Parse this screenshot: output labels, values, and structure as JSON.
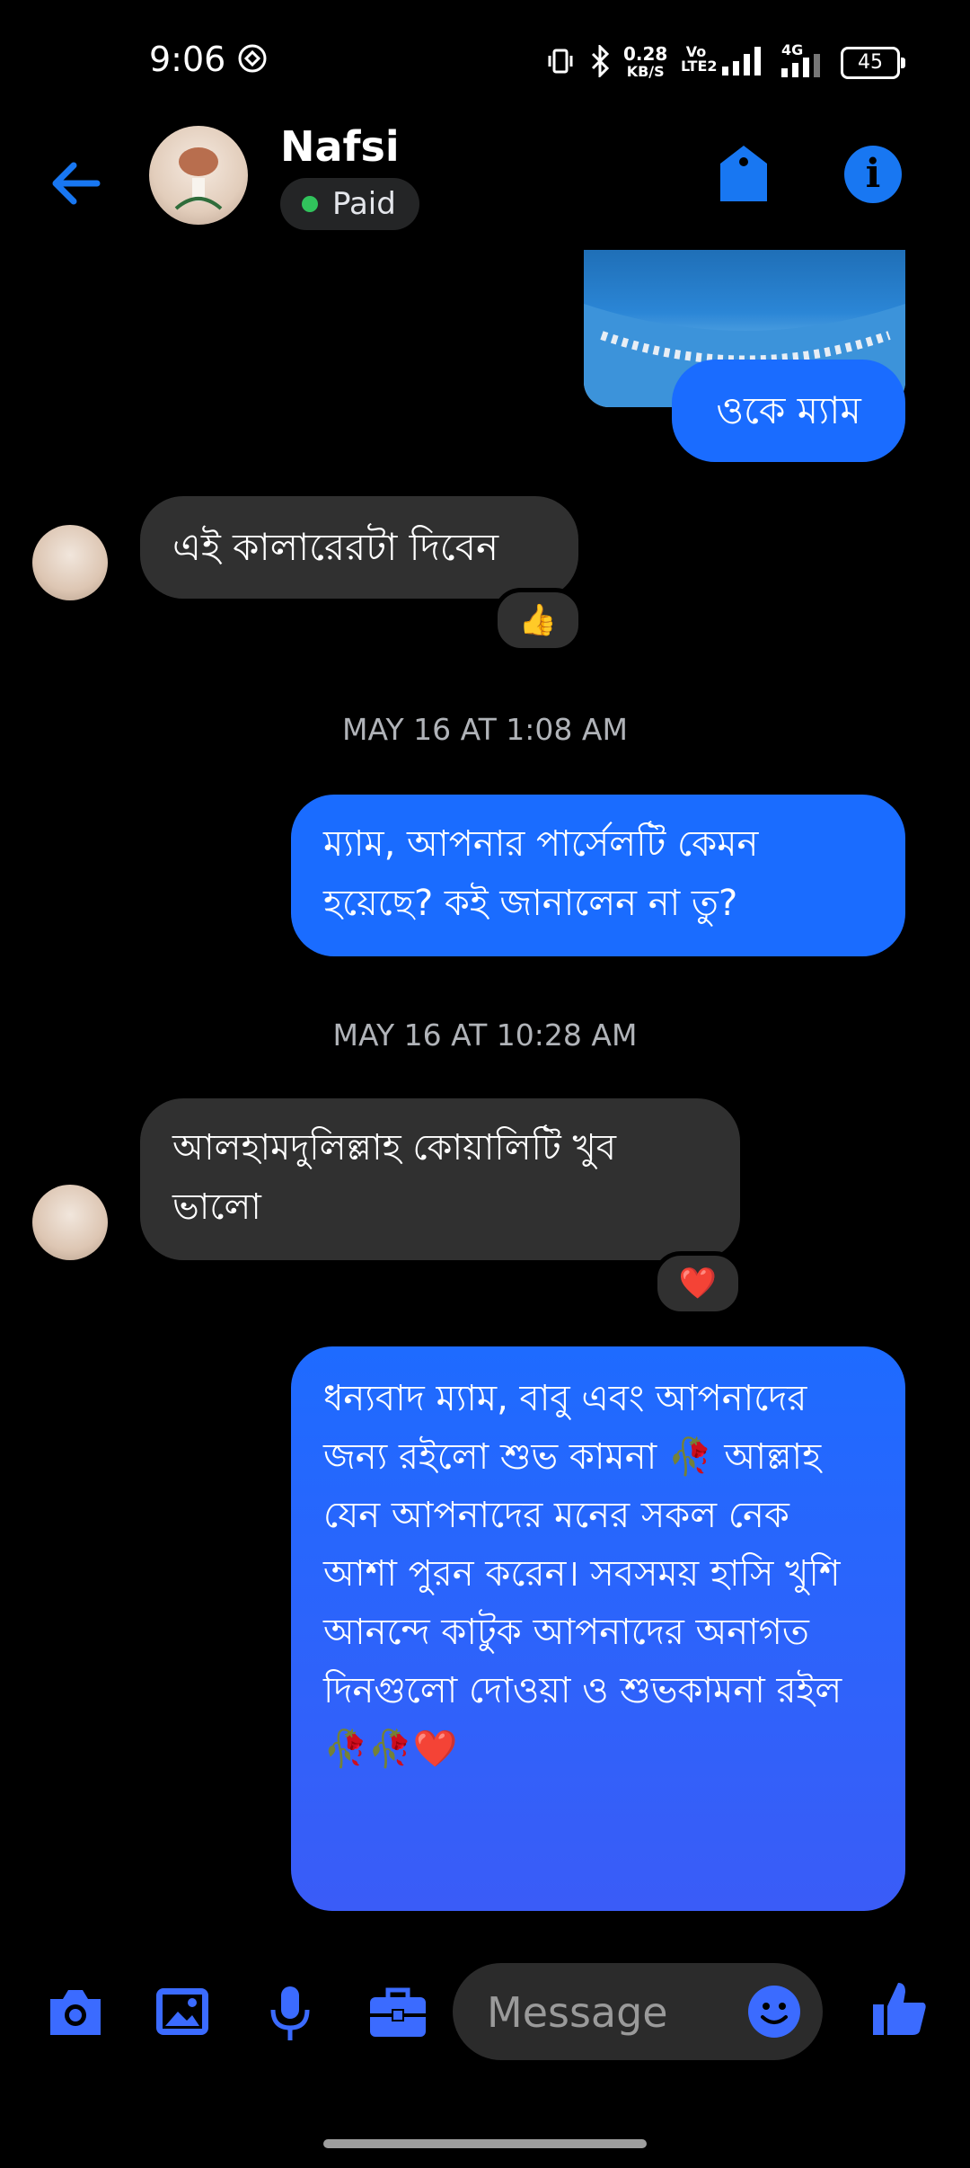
{
  "status": {
    "time": "9:06",
    "speed_value": "0.28",
    "speed_unit": "KB/S",
    "network": "4G",
    "volte": "Vo LTE2",
    "battery": "45"
  },
  "header": {
    "contact_name": "Nafsi",
    "label": "Paid"
  },
  "messages": {
    "m1": "ওকে ম্যাম",
    "m2": "এই কালারেরটা দিবেন",
    "m2_reaction": "👍",
    "ts1": "MAY 16 AT 1:08 AM",
    "m3": "ম্যাম, আপনার পার্সেলটি কেমন হয়েছে? কই জানালেন না তু?",
    "ts2": "MAY 16 AT 10:28 AM",
    "m4": "আলহামদুলিল্লাহ কোয়ালিটি খুব ভালো",
    "m4_reaction": "❤️",
    "m5": "ধন্যবাদ ম্যাম, বাবু এবং আপনাদের জন্য রইলো শুভ কামনা 🥀 আল্লাহ যেন আপনাদের মনের সকল নেক আশা পুরন করেন। সবসময় হাসি খুশি আনন্দে কাটুক আপনাদের অনাগত দিনগুলো দোওয়া ও শুভকামনা রইল 🥀🥀❤️"
  },
  "composer": {
    "placeholder": "Message"
  },
  "colors": {
    "accent": "#1877f2",
    "outgoing": "#1a6cff",
    "incoming": "#303030",
    "online": "#31c35c"
  }
}
